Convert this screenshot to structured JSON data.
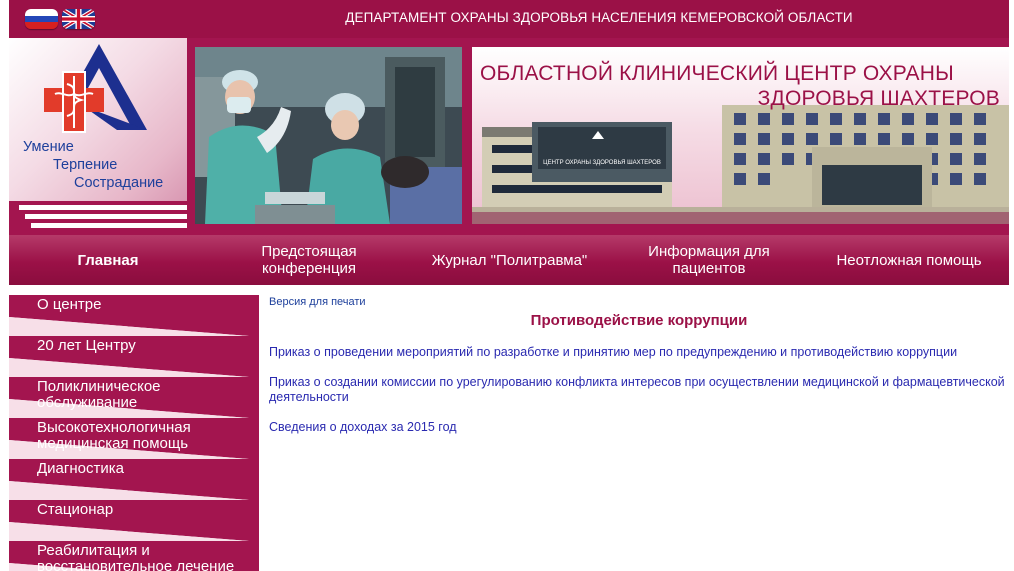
{
  "header": {
    "department": "ДЕПАРТАМЕНТ ОХРАНЫ ЗДОРОВЬЯ НАСЕЛЕНИЯ КЕМЕРОВСКОЙ ОБЛАСТИ",
    "flags": [
      "russia-flag-icon",
      "uk-flag-icon"
    ]
  },
  "logo": {
    "motto": [
      "Умение",
      "Терпение",
      "Сострадание"
    ]
  },
  "banner": {
    "title_line1": "ОБЛАСТНОЙ КЛИНИЧЕСКИЙ ЦЕНТР ОХРАНЫ",
    "title_line2": "ЗДОРОВЬЯ ШАХТЕРОВ",
    "building_sign": "ЦЕНТР ОХРАНЫ ЗДОРОВЬЯ ШАХТЕРОВ"
  },
  "topnav": {
    "items": [
      {
        "label": "Главная"
      },
      {
        "label": "Предстоящая конференция"
      },
      {
        "label": "Журнал \"Политравма\""
      },
      {
        "label": "Информация для пациентов"
      },
      {
        "label": "Неотложная помощь"
      }
    ]
  },
  "sidebar": {
    "items": [
      {
        "label": "О центре"
      },
      {
        "label": "20 лет Центру"
      },
      {
        "label": "Поликлиническое обслуживание"
      },
      {
        "label": "Высокотехнологичная медицинская помощь"
      },
      {
        "label": "Диагностика"
      },
      {
        "label": "Стационар"
      },
      {
        "label": "Реабилитация и восстановительное лечение"
      }
    ]
  },
  "content": {
    "print_link": "Версия для печати",
    "title": "Противодействие коррупции",
    "links": [
      "Приказ о проведении мероприятий по разработке и принятию мер по предупреждению и противодействию коррупции",
      "Приказ о создании комиссии по урегулированию конфликта интересов при осуществлении медицинской и фармацевтической деятельности",
      "Сведения о доходах за 2015 год"
    ]
  },
  "colors": {
    "brand": "#9b1147",
    "link": "#2a2ab0",
    "motto": "#1d3f9b"
  }
}
